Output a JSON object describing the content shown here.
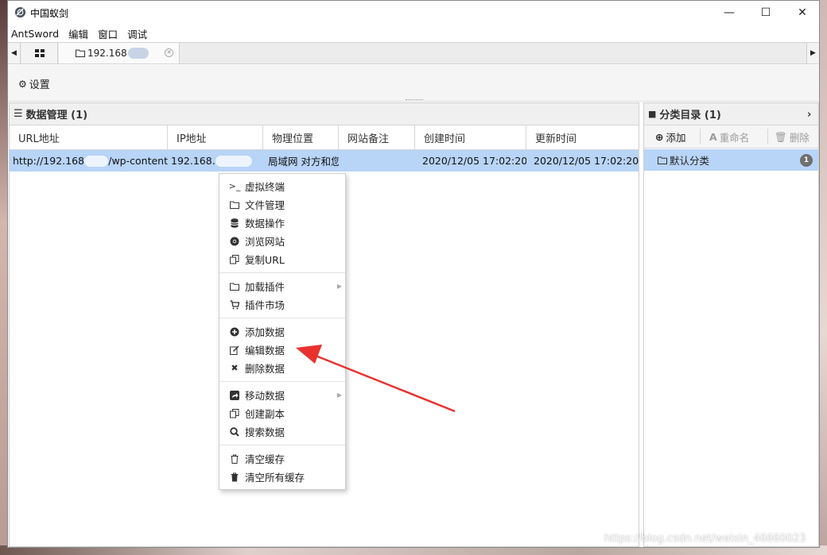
{
  "window": {
    "title": "中国蚁剑",
    "accent_color": "#b8d4f7",
    "controls": {
      "minimize": "—",
      "maximize": "☐",
      "close": "✕"
    }
  },
  "menubar": [
    "AntSword",
    "编辑",
    "窗口",
    "调试"
  ],
  "tabs": {
    "shell_tab_label": "192.168"
  },
  "toolbar": {
    "settings_label": "设置"
  },
  "data_panel": {
    "title": "数据管理 (1)",
    "columns": [
      "URL地址",
      "IP地址",
      "物理位置",
      "网站备注",
      "创建时间",
      "更新时间"
    ],
    "rows": [
      {
        "url_prefix": "http://192.168",
        "url_suffix": "/wp-content",
        "ip_prefix": "192.168.",
        "location": "局域网 对方和您",
        "note": "",
        "created": "2020/12/05 17:02:20",
        "updated": "2020/12/05 17:02:20"
      }
    ]
  },
  "category_panel": {
    "title": "分类目录 (1)",
    "add_label": "添加",
    "rename_label": "重命名",
    "delete_label": "删除",
    "items": [
      {
        "label": "默认分类",
        "count": "1"
      }
    ]
  },
  "context_menu": {
    "items": [
      {
        "label": "虚拟终端",
        "icon": "terminal-icon"
      },
      {
        "label": "文件管理",
        "icon": "folder-icon"
      },
      {
        "label": "数据操作",
        "icon": "database-icon"
      },
      {
        "label": "浏览网站",
        "icon": "chrome-icon"
      },
      {
        "label": "复制URL",
        "icon": "copy-icon"
      },
      {
        "label": "加载插件",
        "icon": "folder-icon",
        "submenu": true
      },
      {
        "label": "插件市场",
        "icon": "cart-icon"
      },
      {
        "label": "添加数据",
        "icon": "plus-circle-icon"
      },
      {
        "label": "编辑数据",
        "icon": "edit-icon"
      },
      {
        "label": "删除数据",
        "icon": "times-icon"
      },
      {
        "label": "移动数据",
        "icon": "share-icon",
        "submenu": true
      },
      {
        "label": "创建副本",
        "icon": "copy-icon"
      },
      {
        "label": "搜索数据",
        "icon": "search-icon"
      },
      {
        "label": "清空缓存",
        "icon": "trash-icon"
      },
      {
        "label": "清空所有缓存",
        "icon": "trash-icon"
      }
    ]
  },
  "watermark": "https://blog.csdn.net/weixin_46660023"
}
